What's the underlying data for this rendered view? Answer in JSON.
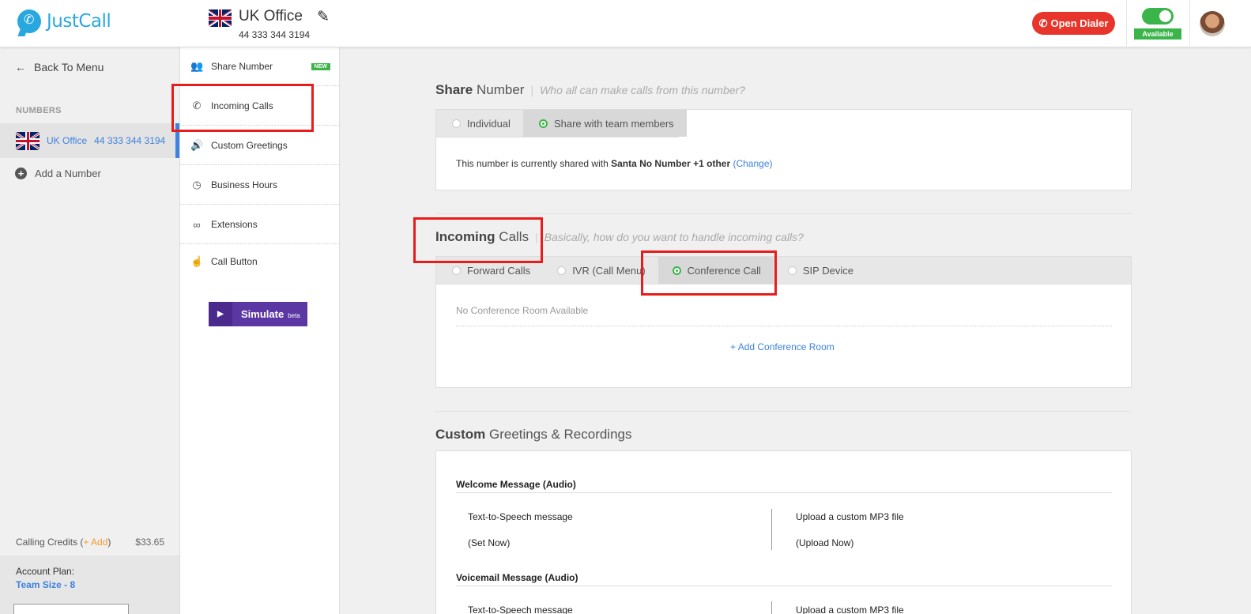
{
  "header": {
    "logo_text": "JustCall",
    "number_name": "UK Office",
    "number_value": "44 333 344 3194",
    "dialer_label": "Open Dialer",
    "status_label": "Available"
  },
  "sidebar": {
    "back_label": "Back To Menu",
    "numbers_heading": "NUMBERS",
    "active_number": {
      "name": "UK Office",
      "number": "44 333 344 3194"
    },
    "add_number_label": "Add a Number",
    "credits": {
      "label": "Calling Credits",
      "add_label": "+ Add",
      "amount": "$33.65"
    },
    "plan": {
      "label": "Account Plan:",
      "value": "Team Size - 8"
    }
  },
  "menu": {
    "items": [
      {
        "label": "Share Number",
        "icon": "users-icon",
        "badge": "NEW"
      },
      {
        "label": "Incoming Calls",
        "icon": "phone-icon"
      },
      {
        "label": "Custom Greetings",
        "icon": "speaker-icon"
      },
      {
        "label": "Business Hours",
        "icon": "clock-icon"
      },
      {
        "label": "Extensions",
        "icon": "link-icon"
      },
      {
        "label": "Call Button",
        "icon": "pointer-icon"
      }
    ],
    "simulate_label": "Simulate",
    "simulate_badge": "beta"
  },
  "share": {
    "title_bold": "Share",
    "title_rest": "Number",
    "hint": "Who all can make calls from this number?",
    "options": [
      "Individual",
      "Share with team members"
    ],
    "selected": "Share with team members",
    "status_prefix": "This number is currently shared with",
    "status_bold": "Santa No Number +1 other",
    "change_label": "(Change)"
  },
  "incoming": {
    "title_bold": "Incoming",
    "title_rest": "Calls",
    "hint": "Basically, how do you want to handle incoming calls?",
    "options": [
      "Forward Calls",
      "IVR (Call Menu)",
      "Conference Call",
      "SIP Device"
    ],
    "selected": "Conference Call",
    "empty_text": "No Conference Room Available",
    "add_label": "Add Conference Room"
  },
  "greetings": {
    "title_bold": "Custom",
    "title_rest": "Greetings & Recordings",
    "welcome_title": "Welcome Message (Audio)",
    "tts_label": "Text-to-Speech message",
    "set_now": "(Set Now)",
    "upload_label": "Upload a custom MP3 file",
    "upload_now": "(Upload Now)",
    "voicemail_title": "Voicemail Message (Audio)"
  },
  "colors": {
    "accent": "#3d82e0",
    "dialer": "#e8352b",
    "available": "#3bb54a",
    "simulate": "#5a37a3",
    "highlight": "#e81c1c"
  }
}
